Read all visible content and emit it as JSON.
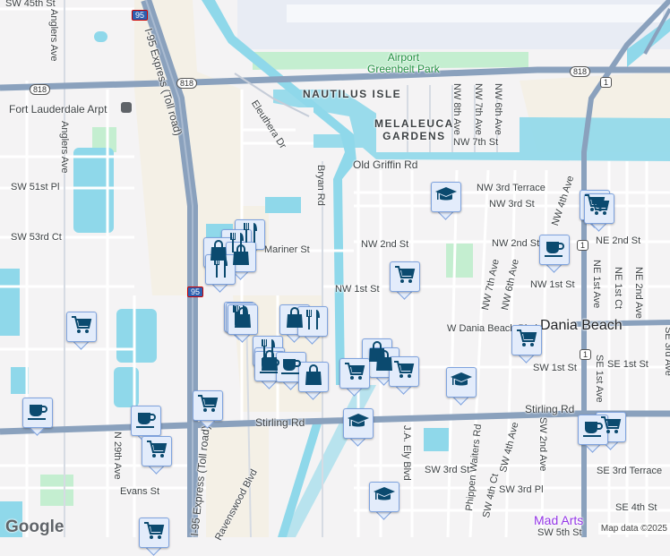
{
  "map": {
    "areas": {
      "nautilus": "NAUTILUS ISLE",
      "melaleuca": "MELALEUCA\nGARDENS",
      "city": "Dania Beach",
      "park": "Airport\nGreenbelt Park",
      "poi": "Mad Arts",
      "station": "Fort Lauderdale Arpt"
    },
    "streets": {
      "sw45": "SW 45th St",
      "anglers1": "Anglers Ave",
      "anglers2": "Anglers Ave",
      "sw51": "SW 51st Pl",
      "sw53": "SW 53rd Ct",
      "i95": "I-95 Express (Toll road)",
      "i95b": "I-95 Express (Toll road)",
      "eleuthera": "Eleuthera Dr",
      "bryan": "Bryan Rd",
      "mariner": "Mariner St",
      "oldgriffin": "Old Griffin Rd",
      "nw7st": "NW 7th St",
      "nw8ave": "NW 8th Ave",
      "nw7ave": "NW 7th Ave",
      "nw6ave": "NW 6th Ave",
      "nw3terr": "NW 3rd Terrace",
      "nw3st": "NW 3rd St",
      "nw2st_a": "NW 2nd St",
      "nw2st_b": "NW 2nd St",
      "ne2st": "NE 2nd St",
      "nw4ave": "NW 4th Ave",
      "nw1st_a": "NW 1st St",
      "nw1st_b": "NW 1st St",
      "nw7ave_b": "NW 7th Ave",
      "nw6ave_b": "NW 6th Ave",
      "ne1ave": "NE 1st Ave",
      "ne1ct": "NE 1st Ct",
      "ne2ave": "NE 2nd Ave",
      "wdania": "W Dania Beach Blvd",
      "sw1st": "SW 1st St",
      "se1st": "SE 1st St",
      "stirling1": "Stirling Rd",
      "stirling2": "Stirling Rd",
      "se1ave": "SE 1st Ave",
      "jaely": "J.A. Ely Blvd",
      "phippen": "Phippen Waiters Rd",
      "sw4ave": "SW 4th Ave",
      "sw4ct": "SW 4th Ct",
      "sw2ave": "SW 2nd Ave",
      "sw3st": "SW 3rd St",
      "sw3pl": "SW 3rd Pl",
      "se3terr": "SE 3rd Terrace",
      "se4st": "SE 4th St",
      "sw5st": "SW 5th St",
      "n29ave": "N 29th Ave",
      "evans": "Evans St",
      "ravenswood": "Ravenswood Blvd",
      "se3ave": "SE 3rd Ave"
    },
    "shields": {
      "r818a": "818",
      "r818b": "818",
      "r818c": "818",
      "us1a": "1",
      "us1b": "1",
      "us1c": "1",
      "i95a": "95",
      "i95b": "95"
    },
    "markers": [
      {
        "type": "education"
      },
      {
        "type": "grocery"
      },
      {
        "type": "grocery"
      },
      {
        "type": "cafe"
      },
      {
        "type": "grocery"
      },
      {
        "type": "grocery"
      },
      {
        "type": "grocery"
      },
      {
        "type": "cafe"
      },
      {
        "type": "cafe"
      },
      {
        "type": "grocery"
      },
      {
        "type": "grocery"
      },
      {
        "type": "grocery"
      },
      {
        "type": "restaurant"
      },
      {
        "type": "restaurant"
      },
      {
        "type": "shopping"
      },
      {
        "type": "shopping"
      },
      {
        "type": "restaurant"
      },
      {
        "type": "restaurant"
      },
      {
        "type": "restaurant"
      },
      {
        "type": "shopping"
      },
      {
        "type": "shopping"
      },
      {
        "type": "restaurant"
      },
      {
        "type": "restaurant"
      },
      {
        "type": "shopping"
      },
      {
        "type": "cafe"
      },
      {
        "type": "cafe"
      },
      {
        "type": "shopping"
      },
      {
        "type": "shopping"
      },
      {
        "type": "shopping"
      },
      {
        "type": "grocery"
      },
      {
        "type": "grocery"
      },
      {
        "type": "education"
      },
      {
        "type": "education"
      },
      {
        "type": "education"
      },
      {
        "type": "grocery"
      },
      {
        "type": "cafe"
      }
    ],
    "colors": {
      "water": "#8fd8ea",
      "highway": "#8aa1bd",
      "park": "#c4eed0",
      "urban": "#f4f0e6",
      "marker_icon": "#0b4a6f",
      "marker_bg": "#e3ecfb"
    }
  },
  "logo": "Google",
  "attribution": "Map data ©2025"
}
